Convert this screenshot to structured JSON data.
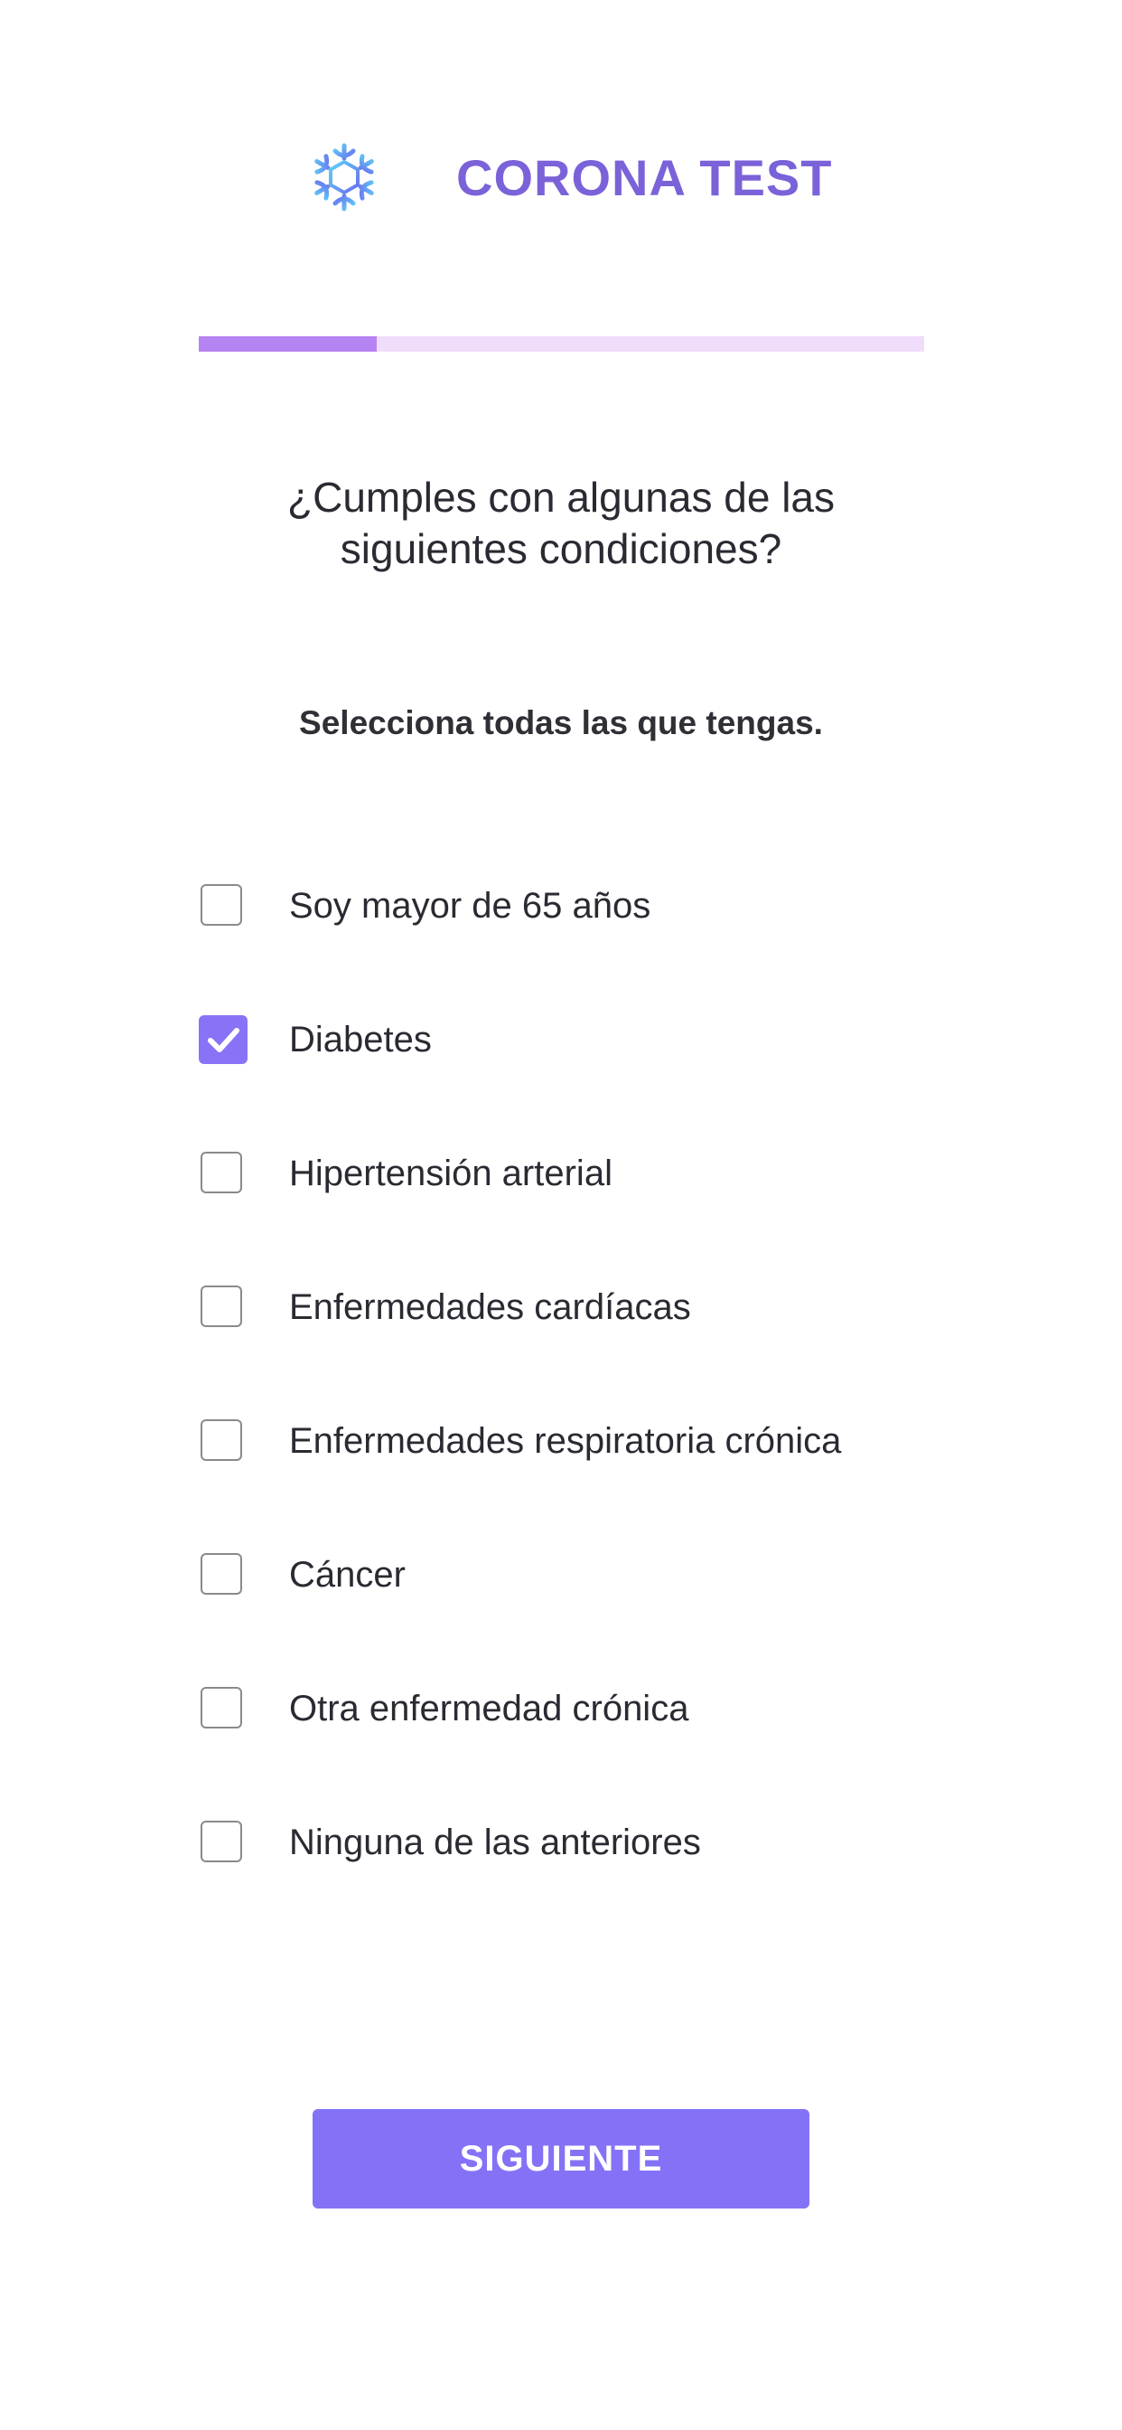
{
  "header": {
    "logo_icon": "virus-molecule-icon",
    "title": "CORONA TEST",
    "brand_color": "#7b62d8"
  },
  "progress": {
    "fraction": 0.245,
    "fill_color": "#b683f2",
    "track_color": "#f0dcfb"
  },
  "question": {
    "line1": "¿Cumples con algunas de las",
    "line2": "siguientes condiciones?"
  },
  "instruction": "Selecciona todas las que tengas.",
  "options": [
    {
      "label": "Soy mayor de 65 años",
      "checked": false
    },
    {
      "label": "Diabetes",
      "checked": true
    },
    {
      "label": "Hipertensión arterial",
      "checked": false
    },
    {
      "label": "Enfermedades cardíacas",
      "checked": false
    },
    {
      "label": "Enfermedades respiratoria crónica",
      "checked": false
    },
    {
      "label": "Cáncer",
      "checked": false
    },
    {
      "label": "Otra enfermedad crónica",
      "checked": false
    },
    {
      "label": "Ninguna de las anteriores",
      "checked": false
    }
  ],
  "next_button": {
    "label": "SIGUIENTE",
    "color": "#8472f6"
  },
  "checkbox_checked_color": "#8a72f6"
}
